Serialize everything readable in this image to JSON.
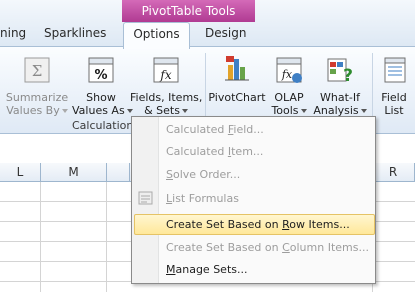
{
  "ribbon": {
    "context_title": "PivotTable Tools",
    "tabs": [
      {
        "label": "ning"
      },
      {
        "label": "Sparklines"
      },
      {
        "label": "Options"
      },
      {
        "label": "Design"
      }
    ],
    "buttons": {
      "summarize": {
        "line1": "Summarize",
        "line2": "Values By"
      },
      "show_values": {
        "line1": "Show",
        "line2": "Values As"
      },
      "fields_items": {
        "line1": "Fields, Items,",
        "line2": "& Sets"
      },
      "pivotchart": {
        "label": "PivotChart"
      },
      "olap": {
        "line1": "OLAP",
        "line2": "Tools"
      },
      "whatif": {
        "line1": "What-If",
        "line2": "Analysis"
      },
      "fieldlist": {
        "line1": "Field",
        "line2": "List"
      }
    },
    "group_label": "Calculation"
  },
  "sheet": {
    "columns": [
      "L",
      "M",
      "R"
    ]
  },
  "menu": {
    "items": [
      {
        "pre": "Calculated ",
        "key": "F",
        "post": "ield...",
        "disabled": true
      },
      {
        "pre": "Calculated ",
        "key": "I",
        "post": "tem...",
        "disabled": true
      },
      {
        "pre": "",
        "key": "S",
        "post": "olve Order...",
        "disabled": true
      },
      {
        "pre": "",
        "key": "L",
        "post": "ist Formulas",
        "disabled": true
      },
      {
        "pre": "Create Set Based on ",
        "key": "R",
        "post": "ow Items...",
        "disabled": false
      },
      {
        "pre": "Create Set Based on ",
        "key": "C",
        "post": "olumn Items...",
        "disabled": true
      },
      {
        "pre": "",
        "key": "M",
        "post": "anage Sets...",
        "disabled": false
      }
    ]
  },
  "colors": {
    "context_band": "#b03a92",
    "highlight": "#ffe89a",
    "ribbon_border": "#a9bfd6"
  }
}
